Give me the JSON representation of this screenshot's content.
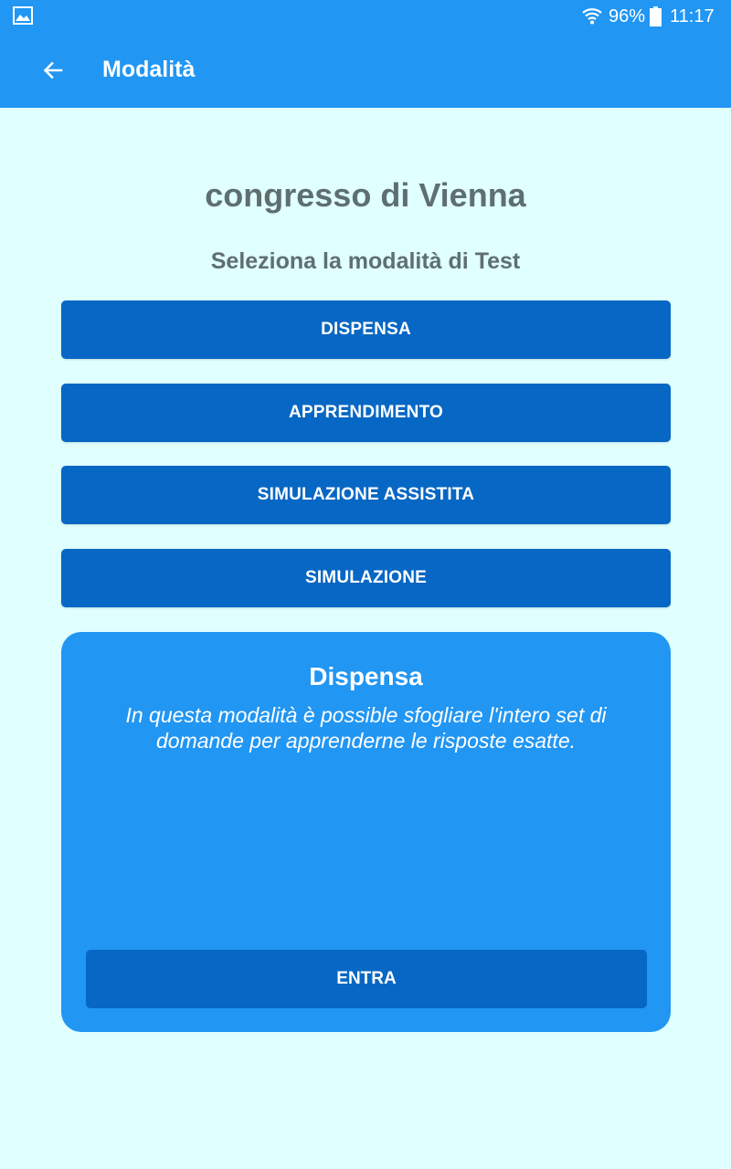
{
  "status_bar": {
    "battery_percent": "96%",
    "time": "11:17",
    "icons": [
      "image-notification-icon",
      "wifi-icon",
      "battery-icon"
    ]
  },
  "app_bar": {
    "back_icon": "arrow-left-icon",
    "title": "Modalità"
  },
  "main": {
    "heading": "congresso di Vienna",
    "subheading": "Seleziona la modalità di Test",
    "modes": [
      {
        "label": "DISPENSA"
      },
      {
        "label": "APPRENDIMENTO"
      },
      {
        "label": "SIMULAZIONE ASSISTITA"
      },
      {
        "label": "SIMULAZIONE"
      }
    ]
  },
  "info_card": {
    "title": "Dispensa",
    "description": "In questa modalità è possible sfogliare l'intero set di domande per apprenderne le risposte esatte.",
    "enter_label": "ENTRA"
  },
  "colors": {
    "primary": "#2196f3",
    "button": "#0767c4",
    "background": "#e0ffff",
    "heading_text": "#5f6f6f"
  }
}
